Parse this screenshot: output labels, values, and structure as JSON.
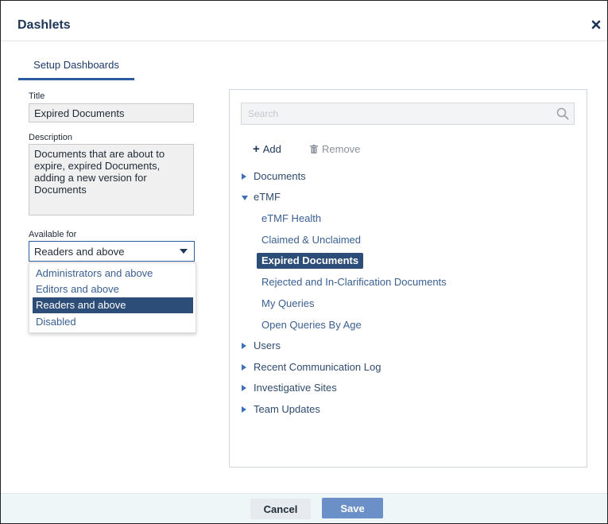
{
  "dialog": {
    "title": "Dashlets",
    "close_icon": "close-icon"
  },
  "tabs": [
    {
      "label": "Setup Dashboards",
      "active": true
    }
  ],
  "form": {
    "title_label": "Title",
    "title_value": "Expired Documents",
    "description_label": "Description",
    "description_value": "Documents that are about to expire, expired Documents, adding a new version for Documents",
    "available_label": "Available for",
    "available_value": "Readers and above",
    "available_options": [
      {
        "label": "Administrators and above",
        "selected": false
      },
      {
        "label": "Editors and above",
        "selected": false
      },
      {
        "label": "Readers and above",
        "selected": true
      },
      {
        "label": "Disabled",
        "selected": false
      }
    ]
  },
  "panel": {
    "search_placeholder": "Search",
    "search_icon": "search-icon",
    "add_label": "Add",
    "remove_label": "Remove",
    "tree": [
      {
        "label": "Documents",
        "expanded": false
      },
      {
        "label": "eTMF",
        "expanded": true,
        "children": [
          {
            "label": "eTMF Health",
            "selected": false
          },
          {
            "label": "Claimed & Unclaimed",
            "selected": false
          },
          {
            "label": "Expired Documents",
            "selected": true
          },
          {
            "label": "Rejected and In-Clarification Documents",
            "selected": false
          },
          {
            "label": "My Queries",
            "selected": false
          },
          {
            "label": "Open Queries By Age",
            "selected": false
          }
        ]
      },
      {
        "label": "Users",
        "expanded": false
      },
      {
        "label": "Recent Communication Log",
        "expanded": false
      },
      {
        "label": "Investigative Sites",
        "expanded": false
      },
      {
        "label": "Team Updates",
        "expanded": false
      }
    ]
  },
  "footer": {
    "cancel_label": "Cancel",
    "save_label": "Save"
  },
  "colors": {
    "accent": "#2c4d78",
    "save_button": "#6b8fc7",
    "footer_bg": "#eef6f8"
  }
}
